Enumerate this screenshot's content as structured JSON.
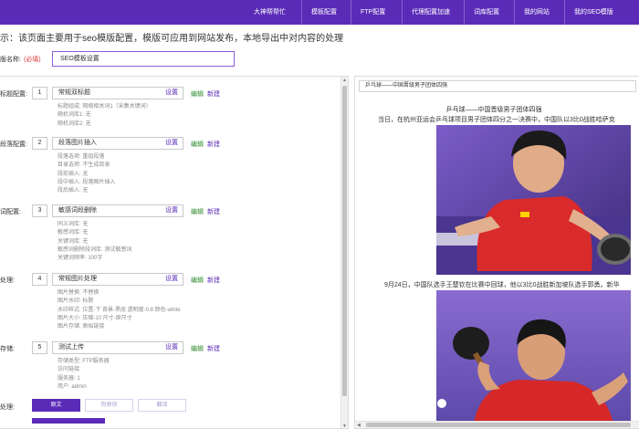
{
  "nav": {
    "items": [
      {
        "label": "大神帮帮忙"
      },
      {
        "label": "模板配置"
      },
      {
        "label": "FTP配置"
      },
      {
        "label": "代理配置加速"
      },
      {
        "label": "词库配置"
      },
      {
        "label": "我的网站"
      },
      {
        "label": "我的SEO模版"
      }
    ],
    "bar_color": "#5b2bb8"
  },
  "notice": "示：该页面主要用于seo模版配置，模版可应用到网站发布，本地导出中对内容的处理",
  "template": {
    "label": "版名称:",
    "required": "(必填)",
    "value": "SEO模板设置"
  },
  "sections": [
    {
      "label": "标题配置:",
      "num": "1",
      "name": "常规双标题",
      "set": "设置",
      "edit": "编辑",
      "new": "新建",
      "details": [
        "标题组成: 网络相关词1（采集关键词）",
        "随机词库1: 无",
        "随机词库2: 无"
      ]
    },
    {
      "label": "段落配置:",
      "num": "2",
      "name": "段落图片插入",
      "set": "设置",
      "edit": "编辑",
      "new": "新建",
      "details": [
        "段落选项: 重组段落",
        "目录选项: 不生成目录",
        "段前插入: 无",
        "段中插入: 段落图片插入",
        "段后插入: 无"
      ]
    },
    {
      "label": "词配置:",
      "num": "3",
      "name": "敏感词段删除",
      "set": "设置",
      "edit": "编辑",
      "new": "新建",
      "details": [
        "同义词库: 无",
        "敏感词库: 无",
        "关键词库: 无",
        "敏感词删除段词库: 测试敏感词",
        "关键词频率: 100字"
      ]
    },
    {
      "label": "处理:",
      "num": "4",
      "name": "常规图片处理",
      "set": "设置",
      "edit": "编辑",
      "new": "新建",
      "details": [
        "图片替换: 不替换",
        "图片水印: 标题",
        "水印样式: 位置-下 背景-黑底 透明度-0.8 颜色-white",
        "图片大小: 压缩-10 尺寸-原尺寸",
        "图片存储: 原始链接"
      ]
    },
    {
      "label": "存储:",
      "num": "5",
      "name": "测试上传",
      "set": "设置",
      "edit": "编辑",
      "new": "新建",
      "details": [
        "存储类型: FTP服务器",
        "访问链接:",
        "服务器: 1",
        "用户: admin"
      ]
    }
  ],
  "processing": {
    "label": "处理:",
    "buttons": [
      {
        "label": "原文",
        "active": true
      },
      {
        "label": "伪原创",
        "active": false
      },
      {
        "label": "翻译",
        "active": false
      }
    ]
  },
  "article": {
    "title_input": "乒乓球——中国晋级男子团体四强",
    "heading": "乒乓球——中国晋级男子团体四强",
    "para1": "当日，在杭州亚运会乒乓球项目男子团体四分之一决赛中，中国队以3比0战胜哈萨克",
    "para2": "9月24日，中国队选手王楚钦在比赛中回球，他以3比0战胜新加坡队选手郭勇。新华"
  }
}
